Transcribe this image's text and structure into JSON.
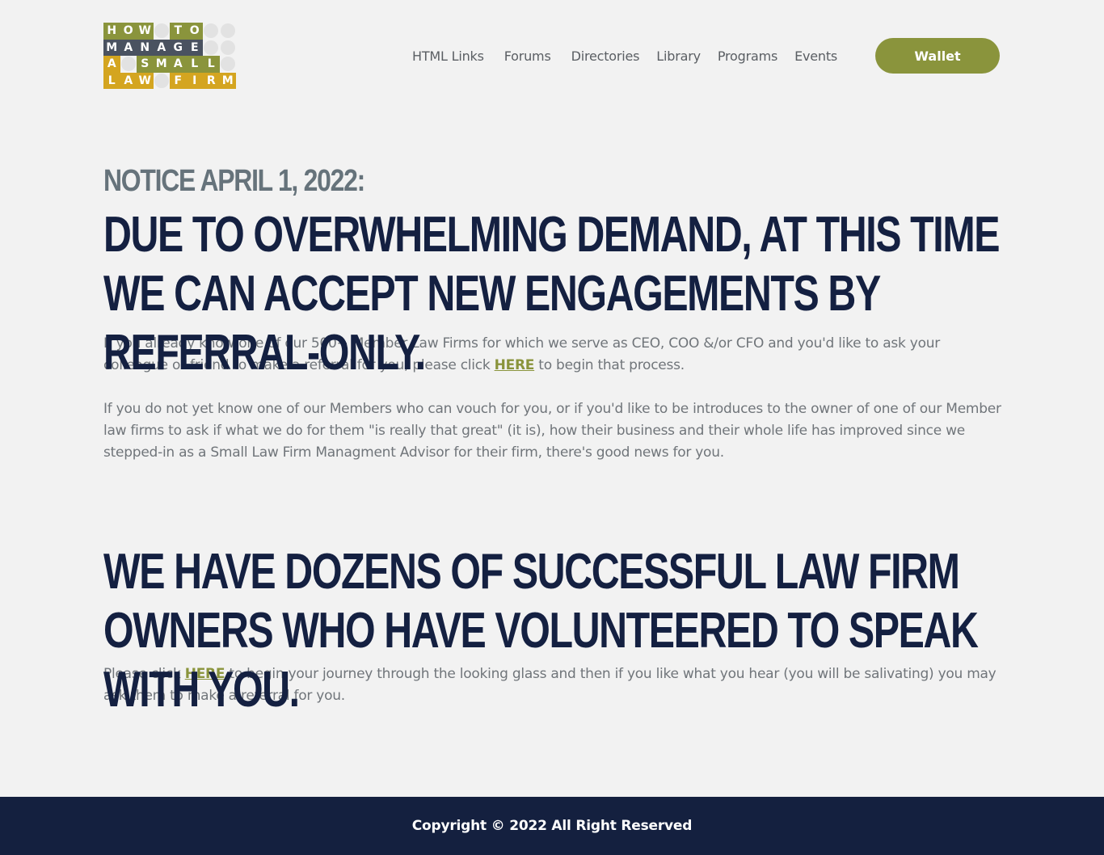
{
  "header": {
    "logo": {
      "alt": "How to Manage a Small Law Firm",
      "rows": [
        [
          {
            "ch": "H",
            "c": "#8a943c"
          },
          {
            "ch": "O",
            "c": "#8a943c"
          },
          {
            "ch": "W",
            "c": "#8a943c"
          },
          {
            "ch": "",
            "c": ""
          },
          {
            "ch": "T",
            "c": "#8a943c"
          },
          {
            "ch": "O",
            "c": "#8a943c"
          },
          {
            "ch": "",
            "c": ""
          },
          {
            "ch": "",
            "c": ""
          }
        ],
        [
          {
            "ch": "M",
            "c": "#4a5260"
          },
          {
            "ch": "A",
            "c": "#4a5260"
          },
          {
            "ch": "N",
            "c": "#4a5260"
          },
          {
            "ch": "A",
            "c": "#4a5260"
          },
          {
            "ch": "G",
            "c": "#4a5260"
          },
          {
            "ch": "E",
            "c": "#4a5260"
          },
          {
            "ch": "",
            "c": ""
          },
          {
            "ch": "",
            "c": ""
          }
        ],
        [
          {
            "ch": "A",
            "c": "#d4a520"
          },
          {
            "ch": "",
            "c": ""
          },
          {
            "ch": "S",
            "c": "#8a943c"
          },
          {
            "ch": "M",
            "c": "#8a943c"
          },
          {
            "ch": "A",
            "c": "#8a943c"
          },
          {
            "ch": "L",
            "c": "#8a943c"
          },
          {
            "ch": "L",
            "c": "#8a943c"
          },
          {
            "ch": "",
            "c": ""
          }
        ],
        [
          {
            "ch": "L",
            "c": "#d4a520"
          },
          {
            "ch": "A",
            "c": "#d4a520"
          },
          {
            "ch": "W",
            "c": "#d4a520"
          },
          {
            "ch": "",
            "c": ""
          },
          {
            "ch": "F",
            "c": "#d4a520"
          },
          {
            "ch": "I",
            "c": "#d4a520"
          },
          {
            "ch": "R",
            "c": "#d4a520"
          },
          {
            "ch": "M",
            "c": "#d4a520"
          }
        ]
      ]
    },
    "nav": {
      "html_links": "HTML Links",
      "forums": "Forums",
      "directories": "Directories",
      "library": "Library",
      "programs": "Programs",
      "events": "Events"
    },
    "wallet_label": "Wallet"
  },
  "main": {
    "notice": "NOTICE APRIL 1, 2022:",
    "heading1": "DUE TO OVERWHELMING DEMAND, AT THIS TIME WE CAN ACCEPT NEW ENGAGEMENTS BY REFERRAL-ONLY.",
    "para1_before": "If you already know one of our 500+ Member Law Firms for which we serve as CEO, COO &/or CFO and you'd like to ask your colleague or friend to make a referral for you, please click ",
    "para1_link": "HERE",
    "para1_after": " to begin that process.",
    "para2": "If you do not yet know one of our Members who can vouch for you, or if you'd like to be introduces to the owner of one of our Member law firms to ask if what we do for them \"is really that great\" (it is), how their business and their whole life has improved since we stepped-in as a Small Law Firm Managment Advisor for their firm, there's good news for you.",
    "heading2": "WE HAVE DOZENS OF SUCCESSFUL LAW FIRM OWNERS WHO HAVE VOLUNTEERED TO SPEAK WITH YOU.",
    "para3_before": "Please click ",
    "para3_link": "HERE",
    "para3_after": " to begin your journey through the looking glass and then if you like what you hear (you will be salivating) you may ask them to make a referral for you."
  },
  "footer": {
    "copyright": "Copyright © 2022 All Right Reserved"
  },
  "colors": {
    "accent": "#8a943c",
    "navy": "#142041",
    "background": "#f2f2f2"
  }
}
